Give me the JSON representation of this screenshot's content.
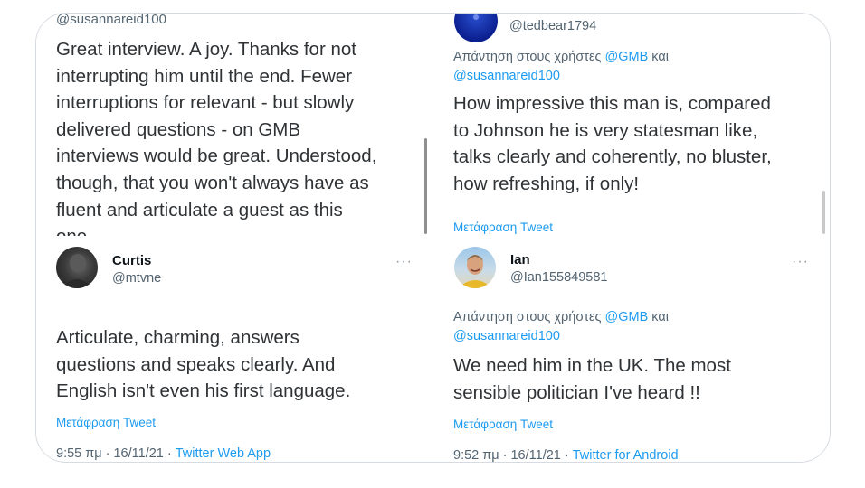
{
  "tweet1": {
    "handle": "@susannareid100",
    "lines": [
      "Great interview. A joy. Thanks for not",
      "interrupting him until the end. Fewer",
      "interruptions for relevant - but slowly",
      "delivered questions - on GMB",
      "interviews would be great. Understood,",
      "though, that you won't always have as",
      "fluent and articulate a guest as this",
      "one"
    ]
  },
  "tweet2": {
    "handle": "@tedbear1794",
    "reply_prefix": "Απάντηση στους χρήστες",
    "mention1": "@GMB",
    "conj": "και",
    "mention2": "@susannareid100",
    "lines": [
      "How impressive this man is, compared",
      "to Johnson he is very statesman like,",
      "talks clearly and coherently, no bluster,",
      "how refreshing, if only!"
    ],
    "translate": "Μετάφραση Tweet"
  },
  "tweet3": {
    "name": "Curtis",
    "handle": "@mtvne",
    "more": "···",
    "lines": [
      "Articulate, charming, answers",
      "questions and speaks clearly. And",
      "English isn't even his first language."
    ],
    "translate": "Μετάφραση Tweet",
    "time": "9:55 πμ · 16/11/21 · ",
    "app": "Twitter Web App"
  },
  "tweet4": {
    "name": "Ian",
    "handle": "@Ian155849581",
    "more": "···",
    "reply_prefix": "Απάντηση στους χρήστες",
    "mention1": "@GMB",
    "conj": "και",
    "mention2": "@susannareid100",
    "lines": [
      "We need him in the UK. The most",
      "sensible politician I've heard !!"
    ],
    "translate": "Μετάφραση Tweet",
    "time": "9:52 πμ · 16/11/21 · ",
    "app": "Twitter for Android"
  },
  "icons": {
    "avatar_ted": "blue-avatar",
    "avatar_curtis": "dark-profile-avatar",
    "avatar_ian": "smiling-man-avatar",
    "more": "more-options-icon"
  },
  "colors": {
    "link": "#1d9bf0",
    "text": "#2f3336",
    "secondary": "#536471",
    "border": "#d6dbe1"
  }
}
